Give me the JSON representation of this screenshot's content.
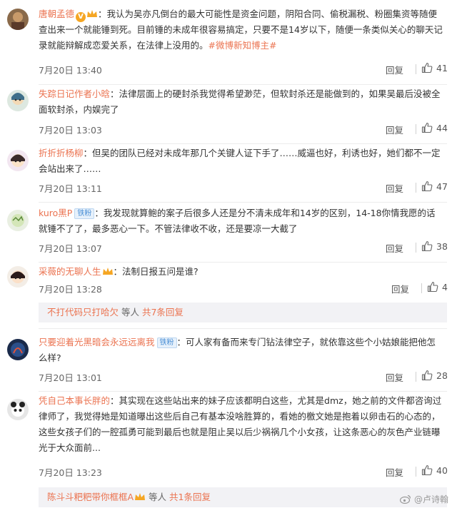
{
  "colors": {
    "username": "#eb7350",
    "meta": "#666666",
    "subreply_bg": "#f2f2f5"
  },
  "comments": [
    {
      "user": "唐朝孟德",
      "text": "：我认为吴亦凡倒台的最大可能性是资金问题，阴阳合同、偷税漏税、粉圈集资等随便查出来一个就能锤到死。目前锤的未成年很容易搞定，只要不是14岁以下，随便一条类似关心的聊天记录就能辩解成恋爱关系，在法律上没用的。",
      "hashtag": "#微博新知博主#",
      "time": "7月20日 13:40",
      "reply": "回复",
      "likes": "41"
    },
    {
      "user": "失踪日记作者小晗",
      "text": "：法律层面上的硬封杀我觉得希望渺茫，但软封杀还是能做到的，如果吴最后没被全面软封杀，内娱完了",
      "time": "7月20日 13:03",
      "reply": "回复",
      "likes": "44"
    },
    {
      "user": "折折折杨柳",
      "text": "：但吴的团队已经对未成年那几个关键人证下手了……威逼也好，利诱也好，她们都不一定会站出来了……",
      "time": "7月20日 13:11",
      "reply": "回复",
      "likes": "47"
    },
    {
      "user": "kuro黑P",
      "badge": "铁粉",
      "text": "：我发现就算鲍的案子后很多人还是分不清未成年和14岁的区别，14-18你情我愿的话就锤不了了，最多恶心一下。不管法律收不收，还是要凉一大截了",
      "time": "7月20日 13:07",
      "reply": "回复",
      "likes": "38"
    },
    {
      "user": "采薇的无聊人生",
      "text": "：法制日报五问是谁?",
      "time": "7月20日 13:28",
      "reply": "回复",
      "likes": "4",
      "subreply": {
        "who": "不打代码只打哈欠",
        "mid": " 等人 ",
        "link": "共7条回复"
      }
    },
    {
      "user": "只要迎着光黑暗会永远远离我",
      "badge": "铁粉",
      "text": "：可人家有备而来专门钻法律空子，就依靠这些个小姑娘能把他怎么样?",
      "time": "7月20日 13:01",
      "reply": "回复",
      "likes": "28"
    },
    {
      "user": "凭自己本事长胖的",
      "text": "：其实现在这些站出来的妹子应该都明白这些，尤其是dmz，她之前的文件都咨询过律师了，我觉得她是知道曝出这些后自己有基本没啥胜算的，看她的檄文她是抱着以卵击石的心态的，这些女孩子们的一腔孤勇可能到最后也就是阻止吴以后少祸祸几个小女孩，让这条恶心的灰色产业链曝光于大众面前...",
      "time": "7月20日 13:23",
      "reply": "回复",
      "likes": "40",
      "subreply": {
        "who": "陈斗斗粑粑带你框框A",
        "mid": " 等人 ",
        "link": "共1条回复"
      }
    }
  ],
  "watermark": "@卢诗翰"
}
